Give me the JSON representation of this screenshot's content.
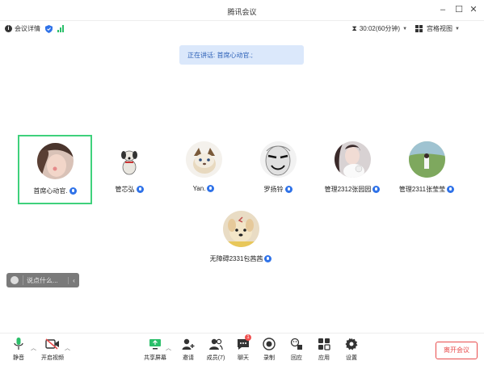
{
  "window": {
    "title": "腾讯会议"
  },
  "infobar": {
    "meeting_info_label": "会议详情",
    "timer": "30:02(60分钟)",
    "view_label": "宫格视图"
  },
  "speaking": {
    "text": "正在讲话: 首席心动官.;"
  },
  "participants": [
    {
      "name": "首席心动官.",
      "active": true
    },
    {
      "name": "管芯弘"
    },
    {
      "name": "Yan."
    },
    {
      "name": "罗扬铃"
    },
    {
      "name": "管理2312张园园"
    },
    {
      "name": "管理2311张莹莹"
    },
    {
      "name": "无障碍2331包茜茜"
    }
  ],
  "chat": {
    "placeholder": "说点什么..."
  },
  "toolbar": {
    "mute": "静音",
    "video": "开启视频",
    "share": "共享屏幕",
    "invite": "邀请",
    "members": "成员(7)",
    "chat": "聊天",
    "chat_badge": "1",
    "record": "录制",
    "react": "回应",
    "apps": "应用",
    "settings": "设置",
    "leave": "离开会议"
  },
  "colors": {
    "accent_green": "#3fd17c",
    "mic_blue": "#2f72e8",
    "leave_red": "#e84c4c",
    "speaking_bg": "#dbe8fb"
  }
}
